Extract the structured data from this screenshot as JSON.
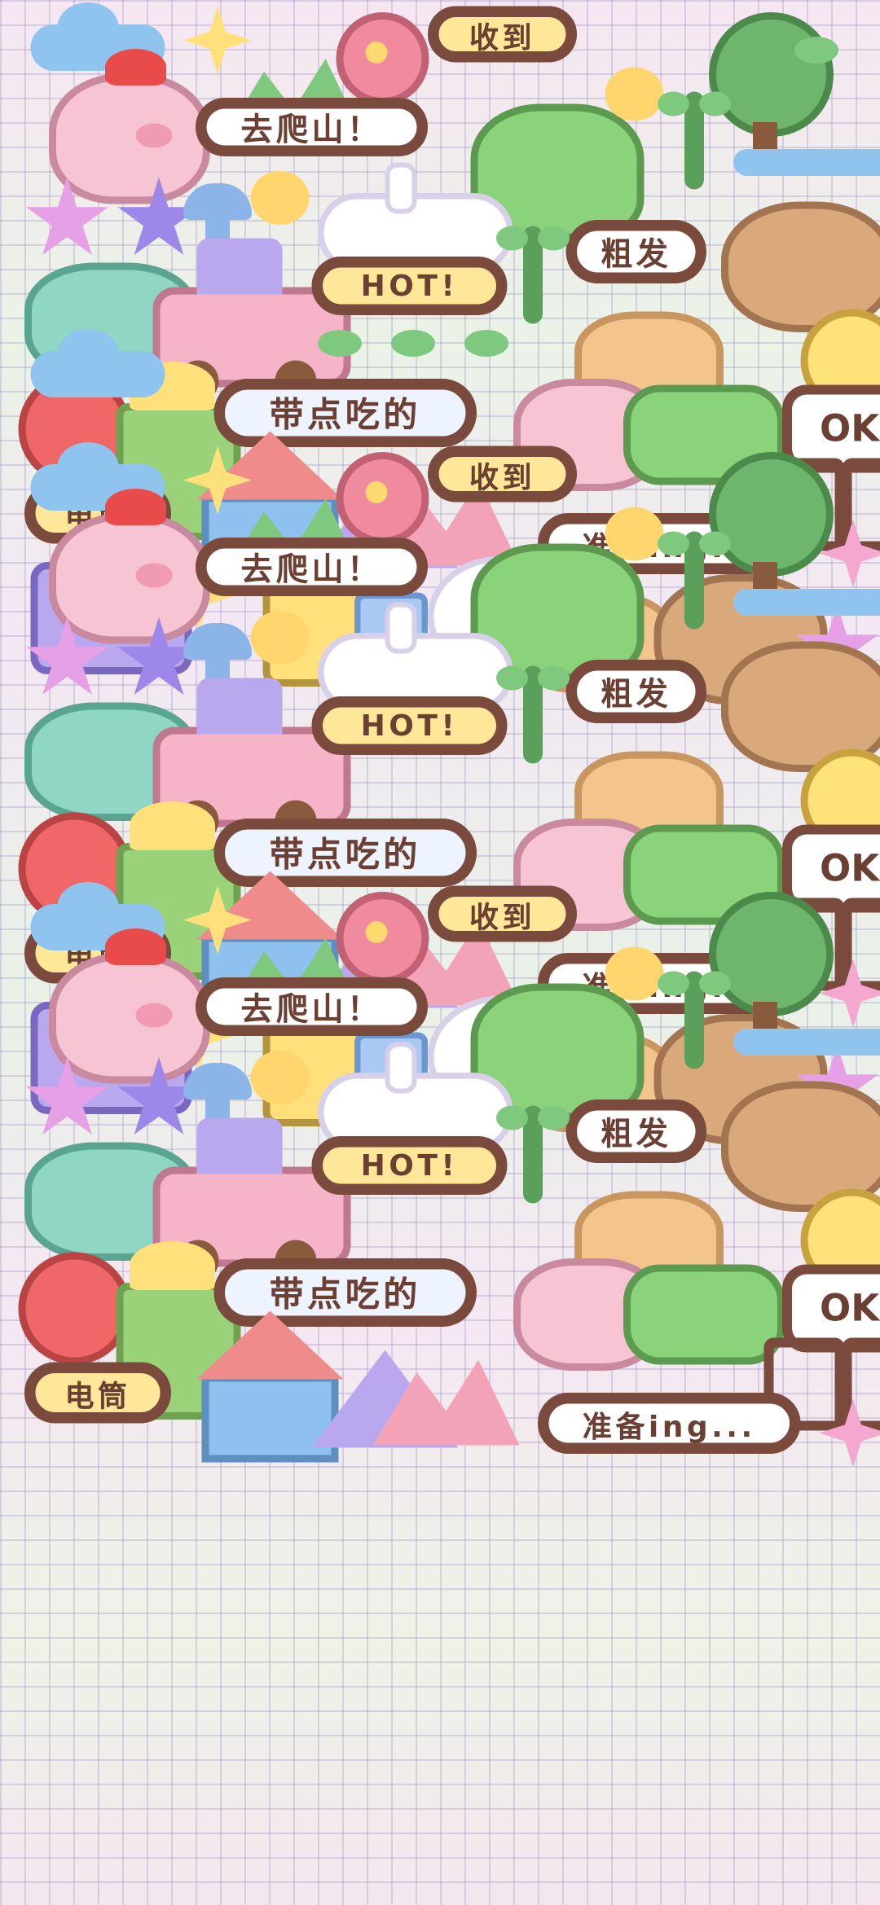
{
  "labels": {
    "received": "收到",
    "hiking": "去爬山！",
    "hot": "HOT!",
    "rough": "粗发",
    "snacks": "带点吃的",
    "flashlight": "电筒",
    "ok": "OK",
    "preparing": "准备ing..."
  },
  "colors": {
    "outline": "#7a4a3c",
    "grid": "#a096c8",
    "pink": "#f7c4d4",
    "green": "#8bd37b",
    "yellow": "#ffe07a",
    "purple": "#b9a8ee",
    "blue": "#8ec4ee"
  },
  "icons": [
    "cloud-icon",
    "pig-icon",
    "sparkle-icon",
    "mountain-icon",
    "flower-icon",
    "frog-icon",
    "tree-icon",
    "car-icon",
    "mushroom-icon",
    "duck-icon",
    "bunny-icon",
    "sprout-icon",
    "fox-icon",
    "lion-icon",
    "smiley-icon",
    "apple-icon",
    "house-icon",
    "tent-icon",
    "cat-icon",
    "crocodile-icon",
    "camera-icon",
    "jar-icon",
    "cup-icon",
    "checkbox-icon",
    "star-icon"
  ]
}
